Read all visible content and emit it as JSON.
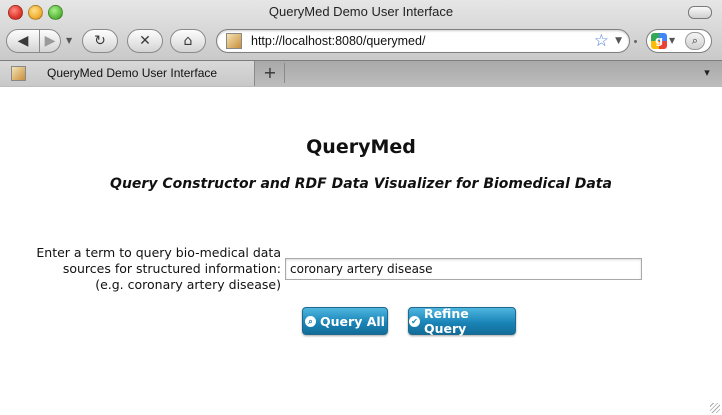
{
  "window": {
    "title": "QueryMed Demo User Interface"
  },
  "toolbar": {
    "url": "http://localhost:8080/querymed/"
  },
  "tab": {
    "title": "QueryMed Demo User Interface",
    "new_tab": "+"
  },
  "page": {
    "title": "QueryMed",
    "subtitle": "Query Constructor and RDF Data Visualizer for Biomedical Data",
    "label_line1": "Enter a term to query bio-medical data",
    "label_line2": "sources for structured information:",
    "label_line3": "(e.g. coronary artery disease)",
    "input_value": "coronary artery disease",
    "query_all_label": "Query All",
    "refine_query_label": "Refine Query"
  },
  "colors": {
    "button_blue": "#1a85b8",
    "chrome_gray": "#bdbdbd"
  },
  "icons": [
    "back-icon",
    "forward-icon",
    "reload-icon",
    "stop-icon",
    "home-icon",
    "star-icon",
    "search-icon",
    "google-icon",
    "tab-menu-icon"
  ]
}
